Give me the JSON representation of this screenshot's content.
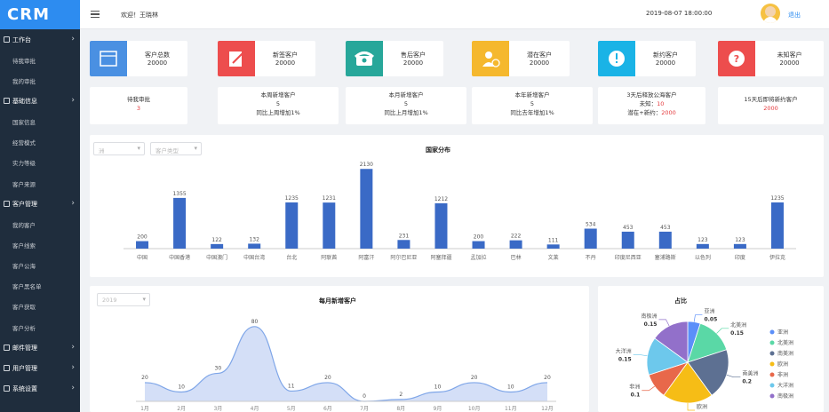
{
  "app": {
    "logo": "CRM"
  },
  "topbar": {
    "welcome": "欢迎！王晓林",
    "datetime": "2019-08-07 18:00:00",
    "logout": "退出"
  },
  "sidebar": [
    {
      "label": "工作台",
      "group": true,
      "icon": "monitor-icon"
    },
    {
      "label": "待我审批"
    },
    {
      "label": "我的审批"
    },
    {
      "label": "基础信息",
      "group": true,
      "icon": "book-icon"
    },
    {
      "label": "国家信息"
    },
    {
      "label": "经营模式"
    },
    {
      "label": "实力等级"
    },
    {
      "label": "客户来源"
    },
    {
      "label": "客户管理",
      "group": true,
      "icon": "users-icon"
    },
    {
      "label": "我的客户"
    },
    {
      "label": "客户线索"
    },
    {
      "label": "客户公海"
    },
    {
      "label": "客户黑名单"
    },
    {
      "label": "客户获取"
    },
    {
      "label": "客户分析"
    },
    {
      "label": "邮件管理",
      "group": true,
      "icon": "mail-icon"
    },
    {
      "label": "用户管理",
      "group": true,
      "icon": "user-icon"
    },
    {
      "label": "系统设置",
      "group": true,
      "icon": "gear-icon"
    }
  ],
  "stats": [
    {
      "label": "客户总数",
      "value": "20000",
      "color": "#4a90e2",
      "icon": "all-icon"
    },
    {
      "label": "新签客户",
      "value": "20000",
      "color": "#ed4d4d",
      "icon": "edit-icon"
    },
    {
      "label": "售后客户",
      "value": "20000",
      "color": "#27a79a",
      "icon": "phone-icon"
    },
    {
      "label": "潜在客户",
      "value": "20000",
      "color": "#f5b82e",
      "icon": "user-clock-icon"
    },
    {
      "label": "新约客户",
      "value": "20000",
      "color": "#1ab3e6",
      "icon": "alert-icon"
    },
    {
      "label": "未知客户",
      "value": "20000",
      "color": "#ed4d4d",
      "icon": "question-icon"
    }
  ],
  "summary": [
    {
      "lines": [
        "待我审批"
      ],
      "value": "3"
    },
    {
      "lines": [
        "本周新增客户",
        "5",
        "同比上周增加1%"
      ]
    },
    {
      "lines": [
        "本月新增客户",
        "5",
        "同比上月增加1%"
      ]
    },
    {
      "lines": [
        "本年新增客户",
        "5",
        "同比去年增加1%"
      ]
    },
    {
      "lines": [
        "3天后释放公海客户"
      ],
      "l2a": "未知：",
      "l2b": "10",
      "l3a": "潜在+新约：",
      "l3b": "2000"
    },
    {
      "lines": [
        "15天后即将新约客户"
      ],
      "value": "2000"
    }
  ],
  "filters": {
    "continent": "洲",
    "type": "客户类型",
    "year": "2019"
  },
  "charts": [
    {
      "type": "bar",
      "title": "国家分布",
      "categories": [
        "中国",
        "中国香港",
        "中国澳门",
        "中国台湾",
        "台北",
        "阿联酋",
        "阿富汗",
        "阿尔巴尼亚",
        "阿塞拜疆",
        "孟加拉",
        "巴林",
        "文莱",
        "不丹",
        "印度尼西亚",
        "塞浦路斯",
        "以色列",
        "印度",
        "伊拉克"
      ],
      "values": [
        200,
        1355,
        122,
        132,
        1235,
        1231,
        2130,
        231,
        1212,
        200,
        222,
        111,
        534,
        453,
        453,
        123,
        123,
        1235
      ],
      "ylim": [
        0,
        2200
      ],
      "color": "#3a6ac6"
    },
    {
      "type": "area",
      "title": "每月新增客户",
      "x": [
        "1月",
        "2月",
        "3月",
        "4月",
        "5月",
        "6月",
        "7月",
        "8月",
        "9月",
        "10月",
        "11月",
        "12月"
      ],
      "values": [
        20,
        10,
        30,
        80,
        11,
        20,
        0,
        2,
        10,
        20,
        10,
        20
      ],
      "ylim": [
        0,
        95
      ],
      "color": "#7fa6e8"
    },
    {
      "type": "pie",
      "title": "占比",
      "labels": [
        "亚洲",
        "北美洲",
        "南美洲",
        "欧洲",
        "非洲",
        "大洋洲",
        "南极洲"
      ],
      "values": [
        0.05,
        0.15,
        0.2,
        0.2,
        0.1,
        0.15,
        0.15
      ],
      "colors": [
        "#5b8ff9",
        "#5ad8a6",
        "#5d7092",
        "#f6bd16",
        "#e8684a",
        "#6dc8ec",
        "#9270ca"
      ],
      "legend": "right"
    }
  ]
}
